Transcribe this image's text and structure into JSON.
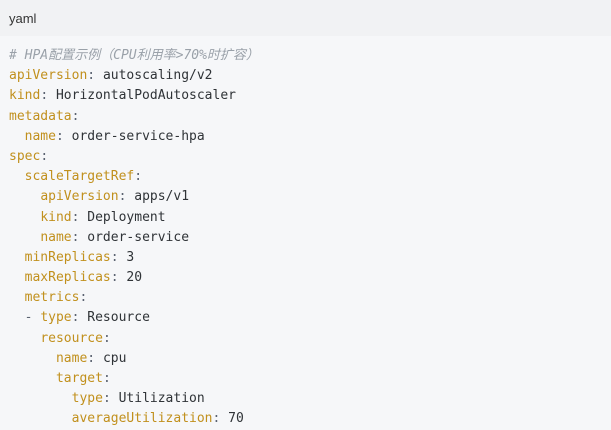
{
  "language_label": "yaml",
  "lines": [
    {
      "indent": "",
      "type": "comment",
      "text": "# HPA配置示例（CPU利用率>70%时扩容）"
    },
    {
      "indent": "",
      "type": "kv",
      "key": "apiVersion",
      "value": "autoscaling/v2"
    },
    {
      "indent": "",
      "type": "kv",
      "key": "kind",
      "value": "HorizontalPodAutoscaler"
    },
    {
      "indent": "",
      "type": "kv",
      "key": "metadata",
      "value": ""
    },
    {
      "indent": "  ",
      "type": "kv",
      "key": "name",
      "value": "order-service-hpa"
    },
    {
      "indent": "",
      "type": "kv",
      "key": "spec",
      "value": ""
    },
    {
      "indent": "  ",
      "type": "kv",
      "key": "scaleTargetRef",
      "value": ""
    },
    {
      "indent": "    ",
      "type": "kv",
      "key": "apiVersion",
      "value": "apps/v1"
    },
    {
      "indent": "    ",
      "type": "kv",
      "key": "kind",
      "value": "Deployment"
    },
    {
      "indent": "    ",
      "type": "kv",
      "key": "name",
      "value": "order-service"
    },
    {
      "indent": "  ",
      "type": "kv",
      "key": "minReplicas",
      "value": "3"
    },
    {
      "indent": "  ",
      "type": "kv",
      "key": "maxReplicas",
      "value": "20"
    },
    {
      "indent": "  ",
      "type": "kv",
      "key": "metrics",
      "value": ""
    },
    {
      "indent": "  ",
      "type": "listkv",
      "key": "type",
      "value": "Resource"
    },
    {
      "indent": "    ",
      "type": "kv",
      "key": "resource",
      "value": ""
    },
    {
      "indent": "      ",
      "type": "kv",
      "key": "name",
      "value": "cpu"
    },
    {
      "indent": "      ",
      "type": "kv",
      "key": "target",
      "value": ""
    },
    {
      "indent": "        ",
      "type": "kv",
      "key": "type",
      "value": "Utilization"
    },
    {
      "indent": "        ",
      "type": "kv",
      "key": "averageUtilization",
      "value": "70"
    }
  ],
  "colors": {
    "background": "#f6f7f9",
    "header": "#f1f2f4",
    "comment": "#9aa1a9",
    "key": "#c1901d",
    "value": "#2f3337"
  }
}
